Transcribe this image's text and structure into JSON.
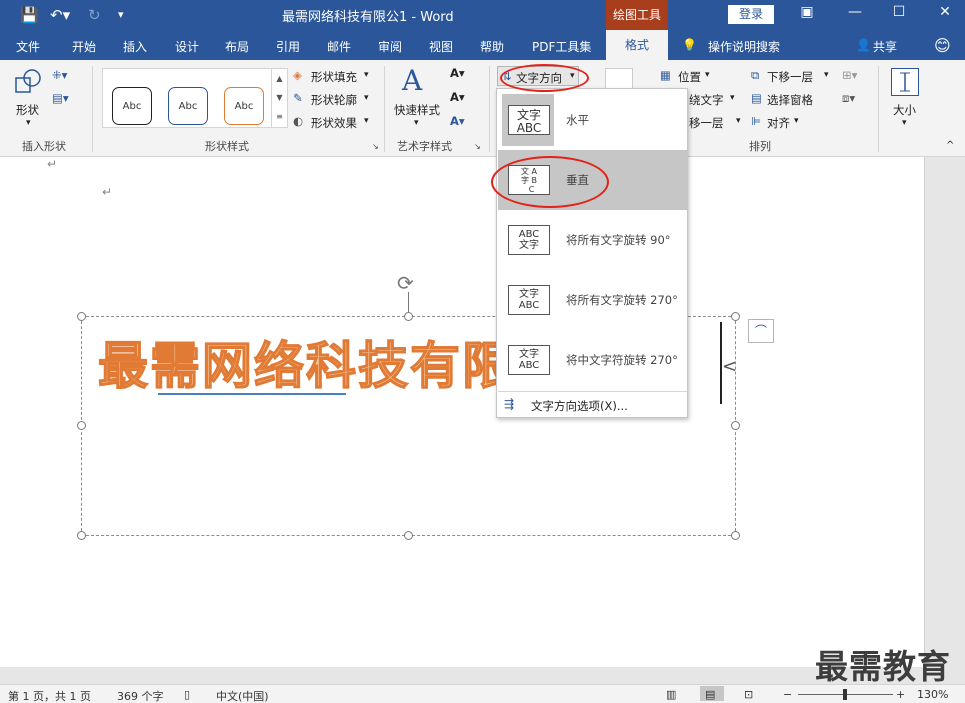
{
  "window": {
    "title": "最需网络科技有限公1 - Word",
    "context_tab": "绘图工具",
    "login": "登录"
  },
  "tabs": [
    "文件",
    "开始",
    "插入",
    "设计",
    "布局",
    "引用",
    "邮件",
    "审阅",
    "视图",
    "帮助",
    "PDF工具集"
  ],
  "active_tab": "格式",
  "tell_me": "操作说明搜索",
  "share": "共享",
  "ribbon": {
    "insert_shapes": {
      "shape_label": "形状",
      "group": "插入形状"
    },
    "shape_styles": {
      "styles": [
        "Abc",
        "Abc",
        "Abc"
      ],
      "fill": "形状填充",
      "outline": "形状轮廓",
      "effects": "形状效果",
      "group": "形状样式"
    },
    "wordart": {
      "quick_styles": "快速样式",
      "group": "艺术字样式"
    },
    "text": {
      "direction": "文字方向"
    },
    "arrange": {
      "position": "位置",
      "wrap": "绕文字",
      "bring_forward": "移一层",
      "send_backward": "下移一层",
      "selection_pane": "选择窗格",
      "align": "对齐",
      "group": "排列"
    },
    "size": {
      "label": "大小"
    }
  },
  "dropdown": {
    "items": [
      {
        "thumb": "文字\nABC",
        "label": "水平"
      },
      {
        "thumb": "文字ABC",
        "label": "垂直"
      },
      {
        "thumb": "文字ABC",
        "label": "将所有文字旋转 90°"
      },
      {
        "thumb": "文字ABC",
        "label": "将所有文字旋转 270°"
      },
      {
        "thumb": "文字ABC",
        "label": "将中文字符旋转 270°"
      }
    ],
    "options": "文字方向选项(X)..."
  },
  "document": {
    "wordart_text": "最需网络科技有限公司"
  },
  "status": {
    "page": "第 1 页，共 1 页",
    "words": "369 个字",
    "language": "中文(中国)",
    "zoom": "130%"
  },
  "watermark": "最需教育",
  "colors": {
    "ribbon_blue": "#2b579a",
    "context_orange": "#a83e1b",
    "wordart_fill": "#f6c99c",
    "wordart_stroke": "#e07a35",
    "highlight": "#e2231a"
  }
}
